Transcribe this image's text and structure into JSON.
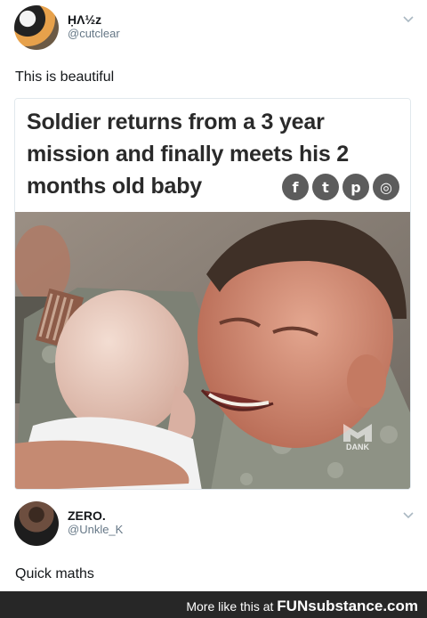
{
  "tweet_top": {
    "avatar_icon": "profile-avatar",
    "display_name": "ḤΛ½z",
    "handle": "@cutclear",
    "text": "This is beautiful"
  },
  "article": {
    "headline": "Soldier returns from a 3 year mission and finally meets his 2 months old baby",
    "social_icons": [
      {
        "name": "facebook-icon",
        "glyph": "f"
      },
      {
        "name": "twitter-icon",
        "glyph": "t"
      },
      {
        "name": "pinterest-icon",
        "glyph": "p"
      },
      {
        "name": "instagram-icon",
        "glyph": "◎"
      }
    ],
    "watermark": "DANK"
  },
  "tweet_bottom": {
    "avatar_icon": "profile-avatar",
    "display_name": "ZERO.",
    "handle": "@Unkle_K",
    "text": "Quick maths"
  },
  "footer": {
    "prefix": "More like this at",
    "brand": "FUNsubstance.com"
  },
  "colors": {
    "handle": "#657786",
    "footer_bg": "#272727",
    "social_bg": "#5c5c5c"
  }
}
